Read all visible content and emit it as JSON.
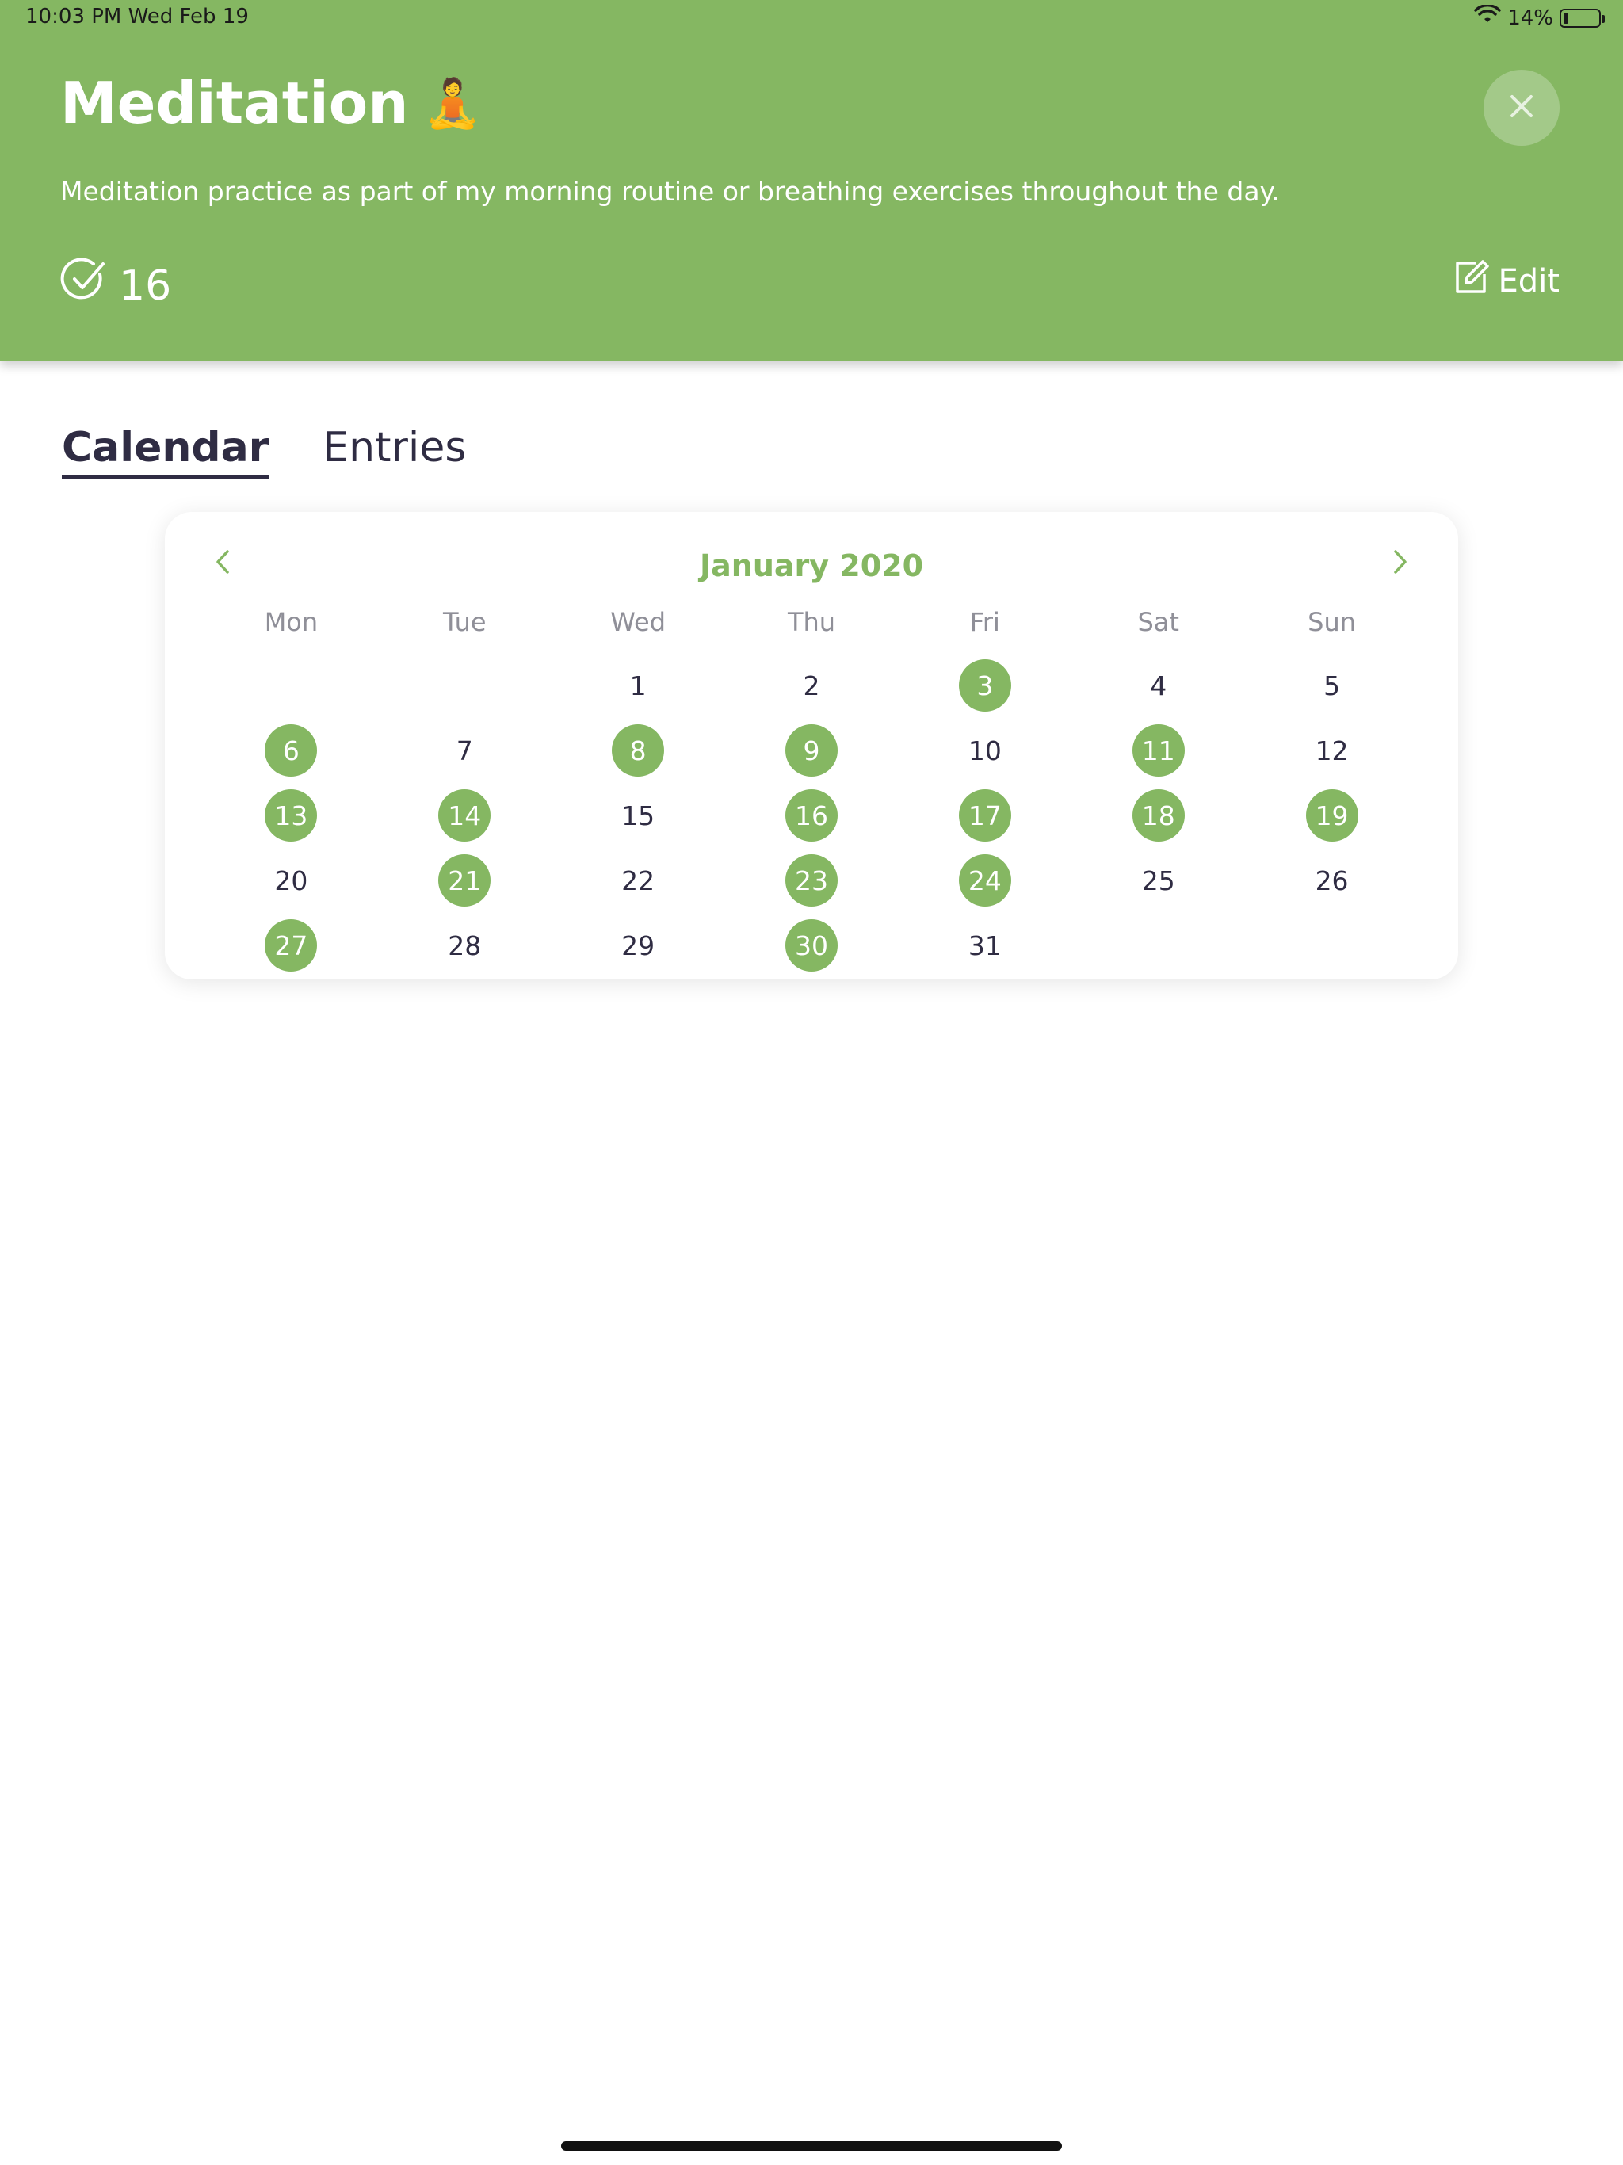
{
  "status_bar": {
    "time": "10:03 PM   Wed Feb 19",
    "battery": "14%",
    "battery_level": 0.14
  },
  "habit": {
    "title": "Meditation",
    "emoji": "🧘",
    "description": "Meditation practice as part of my morning routine or breathing exercises throughout the day.",
    "count": "16",
    "edit_label": "Edit"
  },
  "tabs": [
    {
      "label": "Calendar",
      "active": true
    },
    {
      "label": "Entries",
      "active": false
    }
  ],
  "calendar": {
    "month_label": "January 2020",
    "weekdays": [
      "Mon",
      "Tue",
      "Wed",
      "Thu",
      "Fri",
      "Sat",
      "Sun"
    ],
    "leading_blanks": 2,
    "days_in_month": 31,
    "completed_days": [
      3,
      6,
      8,
      9,
      11,
      13,
      14,
      16,
      17,
      18,
      19,
      21,
      23,
      24,
      27,
      30
    ]
  },
  "colors": {
    "accent": "#85b762",
    "text_dark": "#2f2c43",
    "weekday_gray": "#8f8f98"
  }
}
